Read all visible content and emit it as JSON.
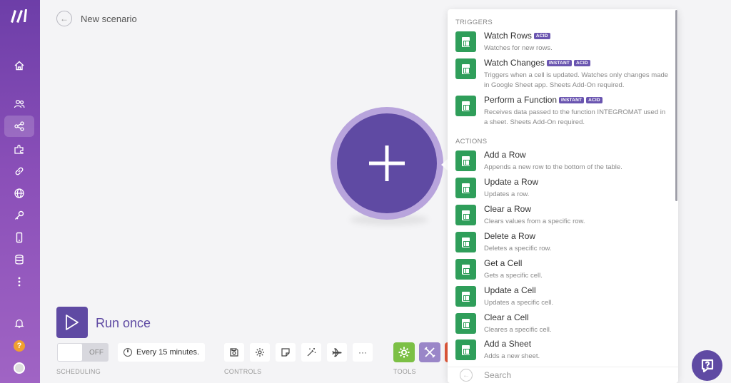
{
  "header": {
    "title": "New scenario"
  },
  "sidebar": {
    "items": [
      {
        "name": "home-icon"
      },
      {
        "name": "team-icon"
      },
      {
        "name": "scenarios-icon"
      },
      {
        "name": "apps-icon"
      },
      {
        "name": "connections-icon"
      },
      {
        "name": "webhooks-icon"
      },
      {
        "name": "keys-icon"
      },
      {
        "name": "devices-icon"
      },
      {
        "name": "datastores-icon"
      },
      {
        "name": "more-icon"
      },
      {
        "name": "notifications-icon"
      }
    ],
    "help_glyph": "?"
  },
  "toolbar": {
    "run_label": "Run once",
    "toggle_label": "OFF",
    "schedule_label": "Every 15 minutes.",
    "scheduling_label": "SCHEDULING",
    "controls_label": "CONTROLS",
    "tools_label": "TOOLS",
    "more_glyph": "···"
  },
  "panel": {
    "triggers_label": "TRIGGERS",
    "actions_label": "ACTIONS",
    "triggers": [
      {
        "title": "Watch Rows",
        "badges": [
          "ACID"
        ],
        "desc": "Watches for new rows."
      },
      {
        "title": "Watch Changes",
        "badges": [
          "INSTANT",
          "ACID"
        ],
        "desc": "Triggers when a cell is updated. Watches only changes made in Google Sheet app. Sheets Add-On required."
      },
      {
        "title": "Perform a Function",
        "badges": [
          "INSTANT",
          "ACID"
        ],
        "desc": "Receives data passed to the function INTEGROMAT used in a sheet. Sheets Add-On required."
      }
    ],
    "actions": [
      {
        "title": "Add a Row",
        "desc": "Appends a new row to the bottom of the table."
      },
      {
        "title": "Update a Row",
        "desc": "Updates a row."
      },
      {
        "title": "Clear a Row",
        "desc": "Clears values from a specific row."
      },
      {
        "title": "Delete a Row",
        "desc": "Deletes a specific row."
      },
      {
        "title": "Get a Cell",
        "desc": "Gets a specific cell."
      },
      {
        "title": "Update a Cell",
        "desc": "Updates a specific cell."
      },
      {
        "title": "Clear a Cell",
        "desc": "Cleares a specific cell."
      },
      {
        "title": "Add a Sheet",
        "desc": "Adds a new sheet."
      }
    ],
    "search_placeholder": "Search"
  },
  "colors": {
    "accent": "#5f4aa3",
    "sheets_green": "#2f9e5a",
    "badge": "#6a55b0"
  }
}
